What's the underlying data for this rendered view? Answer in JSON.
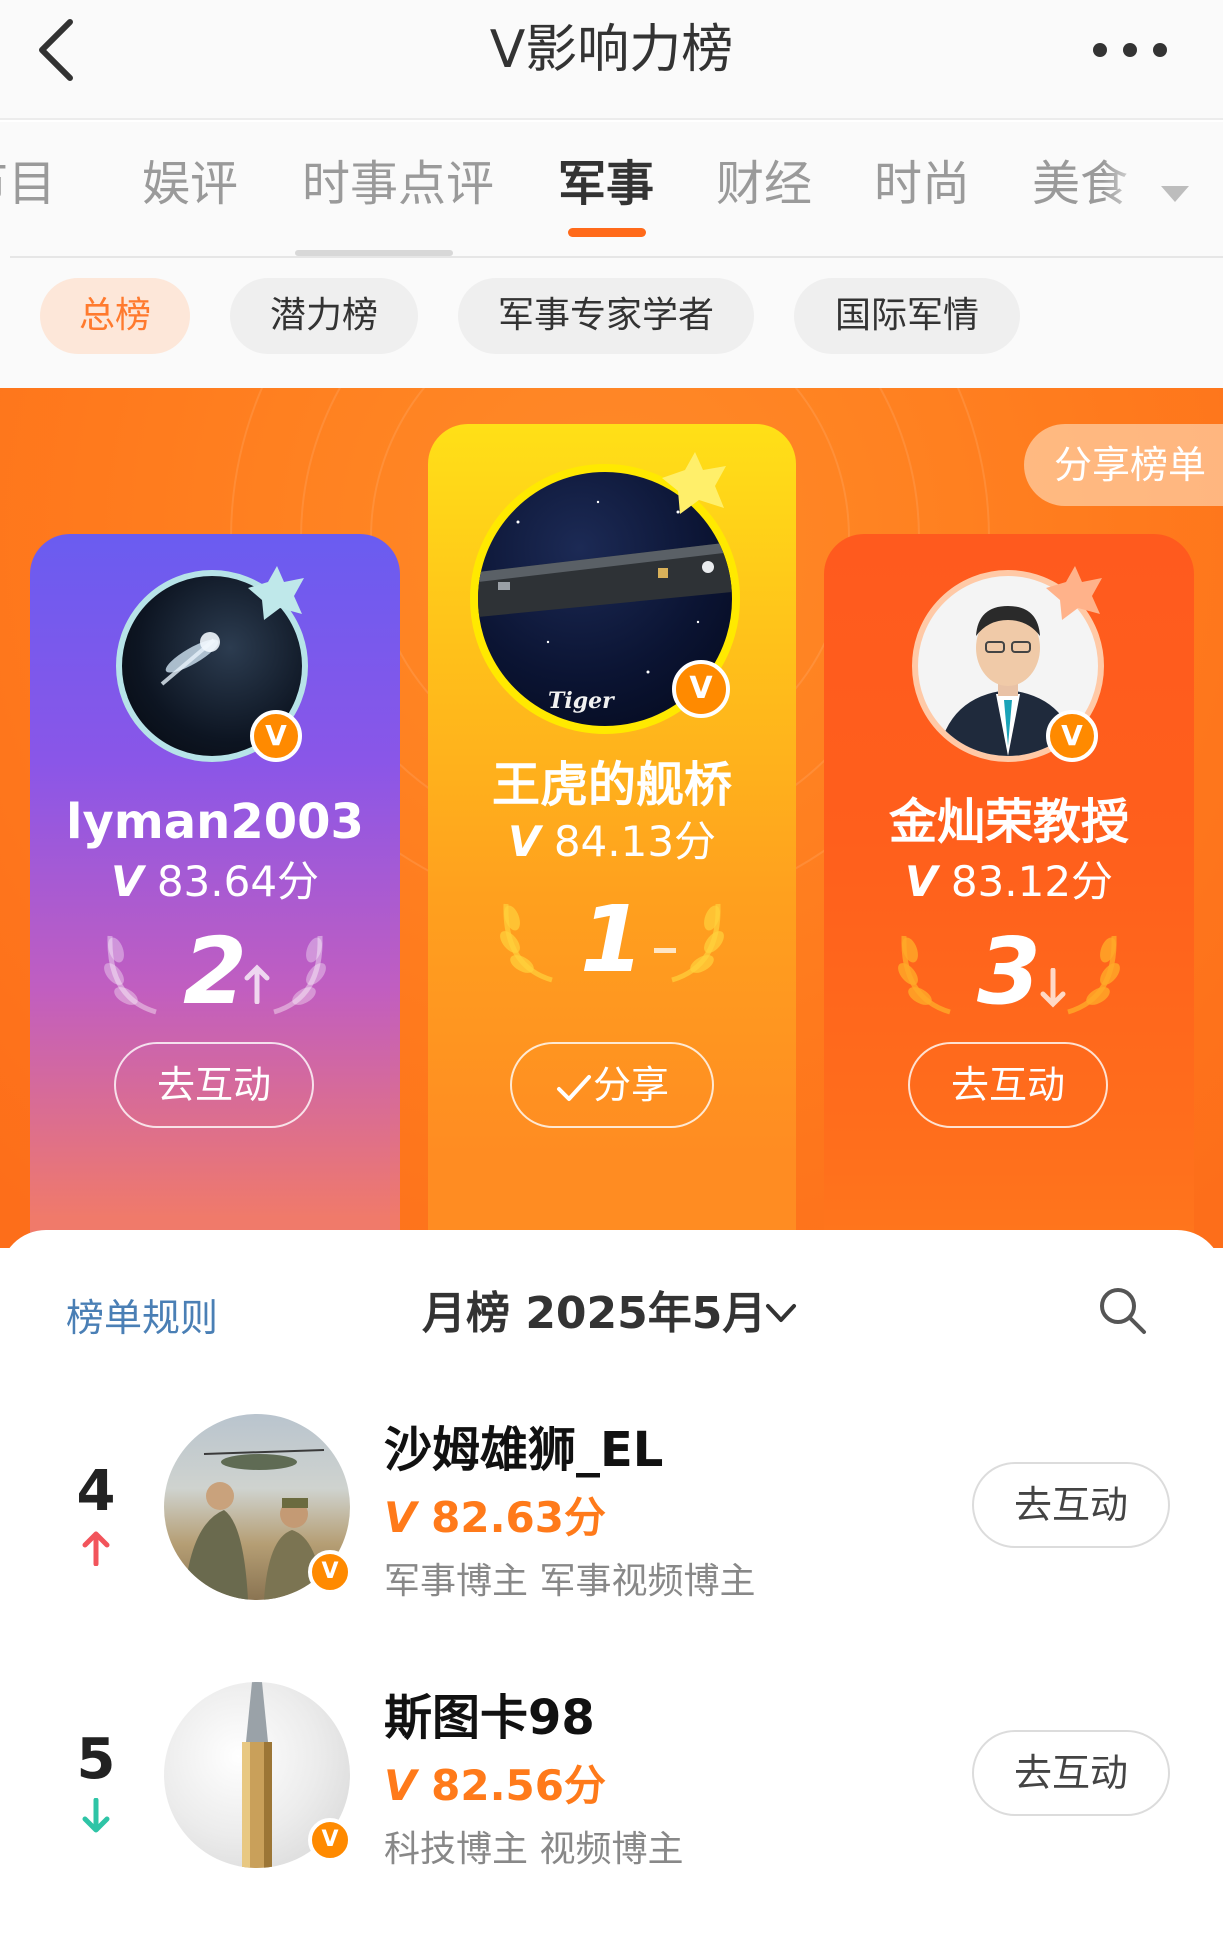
{
  "header": {
    "title": "V影响力榜"
  },
  "categories": [
    {
      "label": "节目",
      "active": false
    },
    {
      "label": "娱评",
      "active": false
    },
    {
      "label": "时事点评",
      "active": false
    },
    {
      "label": "军事",
      "active": true
    },
    {
      "label": "财经",
      "active": false
    },
    {
      "label": "时尚",
      "active": false
    },
    {
      "label": "美食",
      "active": false
    }
  ],
  "chips": [
    {
      "label": "总榜",
      "active": true
    },
    {
      "label": "潜力榜",
      "active": false
    },
    {
      "label": "军事专家学者",
      "active": false
    },
    {
      "label": "国际军情",
      "active": false
    }
  ],
  "podium": {
    "share_list_label": "分享榜单",
    "top3": [
      {
        "rank": "2",
        "name": "lyman2003",
        "v_mark": "V",
        "score": "83.64分",
        "trend": "up",
        "action": "去互动"
      },
      {
        "rank": "1",
        "name": "王虎的舰桥",
        "v_mark": "V",
        "score": "84.13分",
        "trend": "same",
        "action": "分享",
        "avatar_text": "Tiger"
      },
      {
        "rank": "3",
        "name": "金灿荣教授",
        "v_mark": "V",
        "score": "83.12分",
        "trend": "down",
        "action": "去互动"
      }
    ],
    "badge_letter": "V"
  },
  "list": {
    "rules_label": "榜单规则",
    "period_label": "月榜 2025年5月",
    "rows": [
      {
        "rank": "4",
        "trend": "up",
        "name": "沙姆雄狮_EL",
        "v_mark": "V",
        "score": "82.63分",
        "tags": "军事博主 军事视频博主",
        "action": "去互动"
      },
      {
        "rank": "5",
        "trend": "down",
        "name": "斯图卡98",
        "v_mark": "V",
        "score": "82.56分",
        "tags": "科技博主 视频博主",
        "action": "去互动"
      }
    ]
  },
  "colors": {
    "accent": "#ff6a1a",
    "trend_up": "#f2545b",
    "trend_down": "#2ec4a6",
    "link": "#4a7fb5"
  }
}
